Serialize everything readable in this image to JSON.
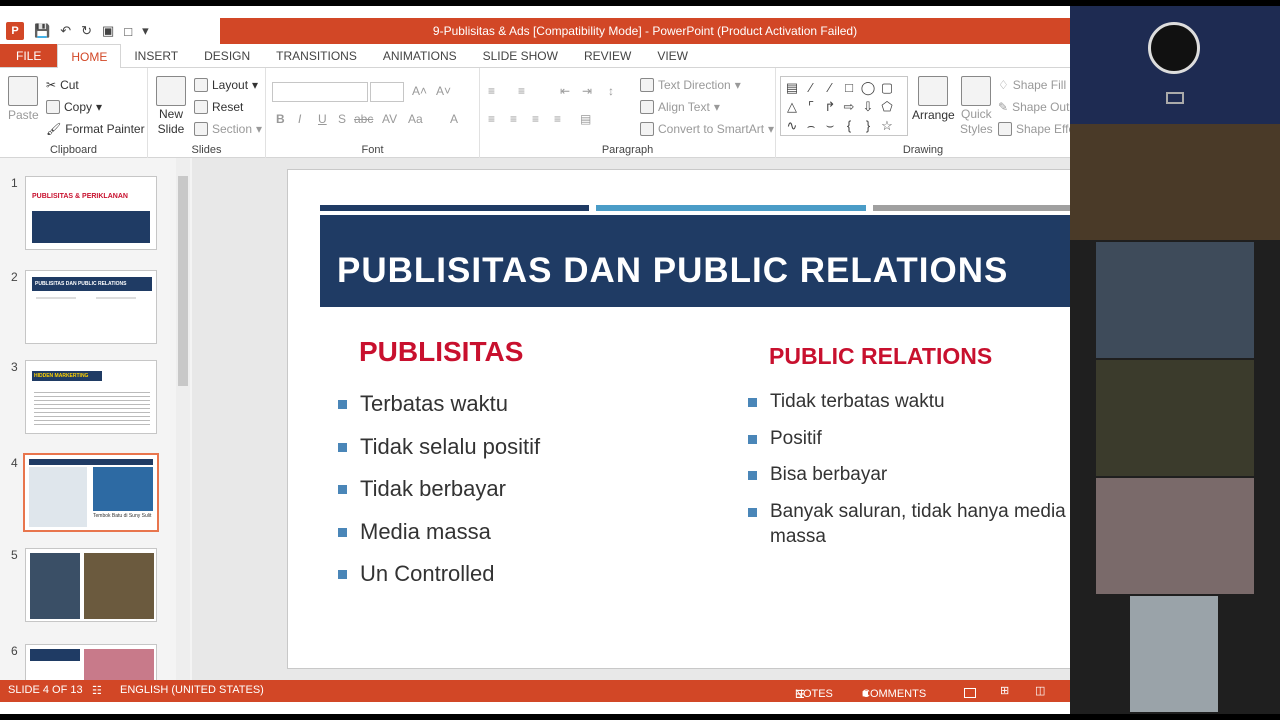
{
  "window": {
    "title": "9-Publisitas & Ads [Compatibility Mode] -  PowerPoint (Product Activation Failed)"
  },
  "tabs": [
    "FILE",
    "HOME",
    "INSERT",
    "DESIGN",
    "TRANSITIONS",
    "ANIMATIONS",
    "SLIDE SHOW",
    "REVIEW",
    "VIEW"
  ],
  "ribbon": {
    "clipboard": {
      "paste": "Paste",
      "cut": "Cut",
      "copy": "Copy",
      "format_painter": "Format Painter",
      "label": "Clipboard"
    },
    "slides": {
      "new_slide_1": "New",
      "new_slide_2": "Slide",
      "layout": "Layout",
      "reset": "Reset",
      "section": "Section",
      "label": "Slides"
    },
    "font": {
      "bold": "B",
      "italic": "I",
      "underline": "U",
      "shadow": "S",
      "strike": "abc",
      "spacing": "AV",
      "case": "Aa",
      "color": "A",
      "label": "Font"
    },
    "paragraph": {
      "text_direction": "Text Direction",
      "align_text": "Align Text",
      "smartart": "Convert to SmartArt",
      "label": "Paragraph"
    },
    "drawing": {
      "arrange": "Arrange",
      "quick_1": "Quick",
      "quick_2": "Styles",
      "shape_fill": "Shape Fill",
      "shape_outline": "Shape Outl",
      "shape_effects": "Shape Effe",
      "label": "Drawing"
    }
  },
  "thumbs": [
    {
      "num": "1",
      "title": "PUBLISITAS & PERIKLANAN"
    },
    {
      "num": "2",
      "title": "PUBLISITAS DAN PUBLIC RELATIONS"
    },
    {
      "num": "3",
      "title": "HIDDEN MARKERTING"
    },
    {
      "num": "4",
      "caption": "Tembok Batu di Suny Sulit"
    },
    {
      "num": "5"
    },
    {
      "num": "6"
    }
  ],
  "slide": {
    "title": "PUBLISITAS DAN PUBLIC RELATIONS",
    "left_title": "PUBLISITAS",
    "left_items": [
      "Terbatas waktu",
      "Tidak selalu positif",
      "Tidak berbayar",
      "Media massa",
      "Un Controlled"
    ],
    "right_title": "PUBLIC RELATIONS",
    "right_items": [
      "Tidak terbatas waktu",
      "Positif",
      "Bisa berbayar",
      "Banyak saluran, tidak hanya media massa"
    ]
  },
  "status": {
    "slide": "SLIDE 4 OF 13",
    "language": "ENGLISH (UNITED STATES)",
    "notes": "NOTES",
    "comments": "COMMENTS"
  },
  "colors": {
    "accent": "#d24726",
    "title_band": "#1f3b64",
    "bullet": "#4a86b8",
    "heading_red": "#c8102e"
  }
}
